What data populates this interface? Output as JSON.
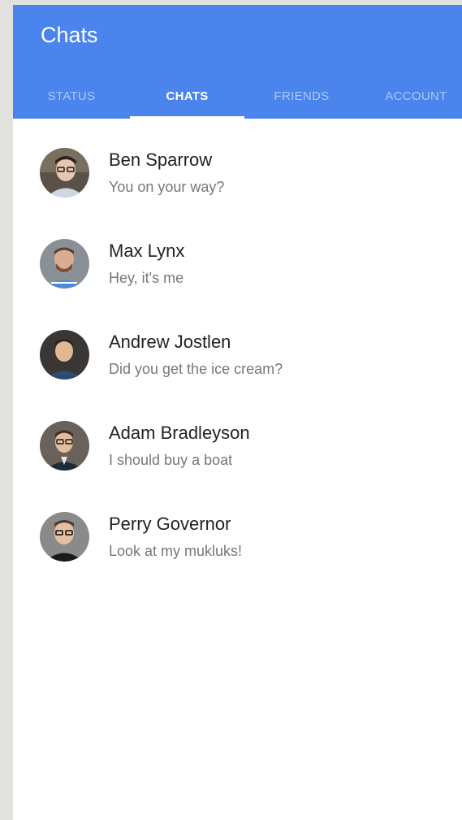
{
  "header": {
    "title": "Chats",
    "color": "#4a84ec"
  },
  "tabs": [
    {
      "label": "STATUS",
      "active": false
    },
    {
      "label": "CHATS",
      "active": true
    },
    {
      "label": "FRIENDS",
      "active": false
    },
    {
      "label": "ACCOUNT",
      "active": false
    }
  ],
  "chats": [
    {
      "name": "Ben Sparrow",
      "last_message": "You on your way?",
      "avatar_icon": "person-avatar"
    },
    {
      "name": "Max Lynx",
      "last_message": "Hey, it's me",
      "avatar_icon": "person-avatar"
    },
    {
      "name": "Andrew Jostlen",
      "last_message": "Did you get the ice cream?",
      "avatar_icon": "person-avatar"
    },
    {
      "name": "Adam Bradleyson",
      "last_message": "I should buy a boat",
      "avatar_icon": "person-avatar"
    },
    {
      "name": "Perry Governor",
      "last_message": "Look at my mukluks!",
      "avatar_icon": "person-avatar"
    }
  ]
}
